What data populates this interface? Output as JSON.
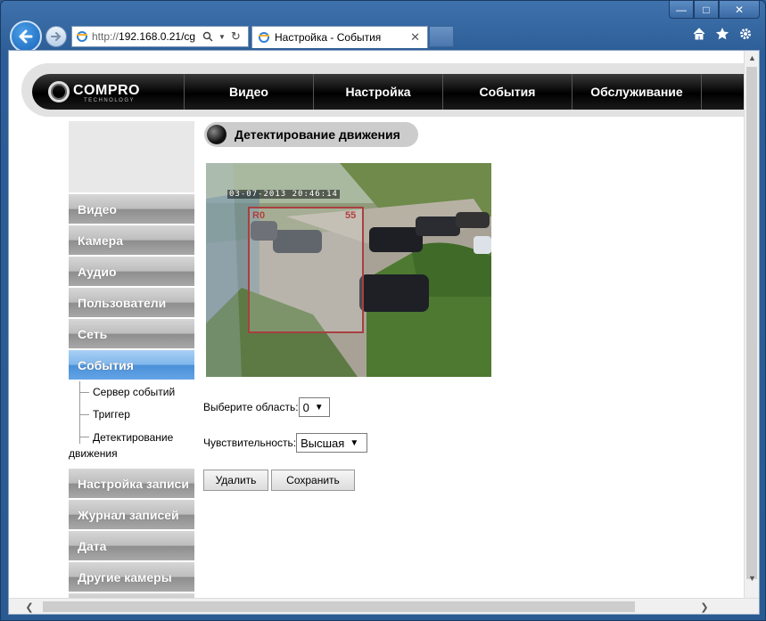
{
  "browser": {
    "address_prefix": "http://",
    "address_host": "192.168.0.21/cg",
    "tab_title": "Настройка - События",
    "window_buttons": [
      "minimize-icon",
      "maximize-icon",
      "close-icon"
    ],
    "toolbar_icons": [
      "home-icon",
      "star-icon",
      "gear-icon"
    ]
  },
  "header": {
    "logo": "COMPRO",
    "logo_sub": "TECHNOLOGY",
    "nav": [
      "Видео",
      "Настройка",
      "События",
      "Обслуживание"
    ]
  },
  "sidebar": {
    "items": [
      {
        "label": "Видео"
      },
      {
        "label": "Камера"
      },
      {
        "label": "Аудио"
      },
      {
        "label": "Пользователи"
      },
      {
        "label": "Сеть"
      },
      {
        "label": "События",
        "active": true
      }
    ],
    "sub_items": [
      "Сервер событий",
      "Триггер",
      "Детектирование движения"
    ],
    "items_after": [
      {
        "label": "Настройка записи"
      },
      {
        "label": "Журнал записей"
      },
      {
        "label": "Дата"
      },
      {
        "label": "Другие камеры"
      }
    ]
  },
  "main": {
    "title": "Детектирование движения",
    "camera": {
      "timestamp": "03-07-2013  20:46:14",
      "zone_label_left": "R0",
      "zone_label_right": "55"
    },
    "area_label": "Выберите область:",
    "area_value": "0",
    "sensitivity_label": "Чувствительность:",
    "sensitivity_value": "Высшая",
    "delete_label": "Удалить",
    "save_label": "Сохранить"
  },
  "colors": {
    "accent_active": "#4a8fd8",
    "nav_bg": "#000000",
    "window_chrome": "#2c5d96"
  }
}
